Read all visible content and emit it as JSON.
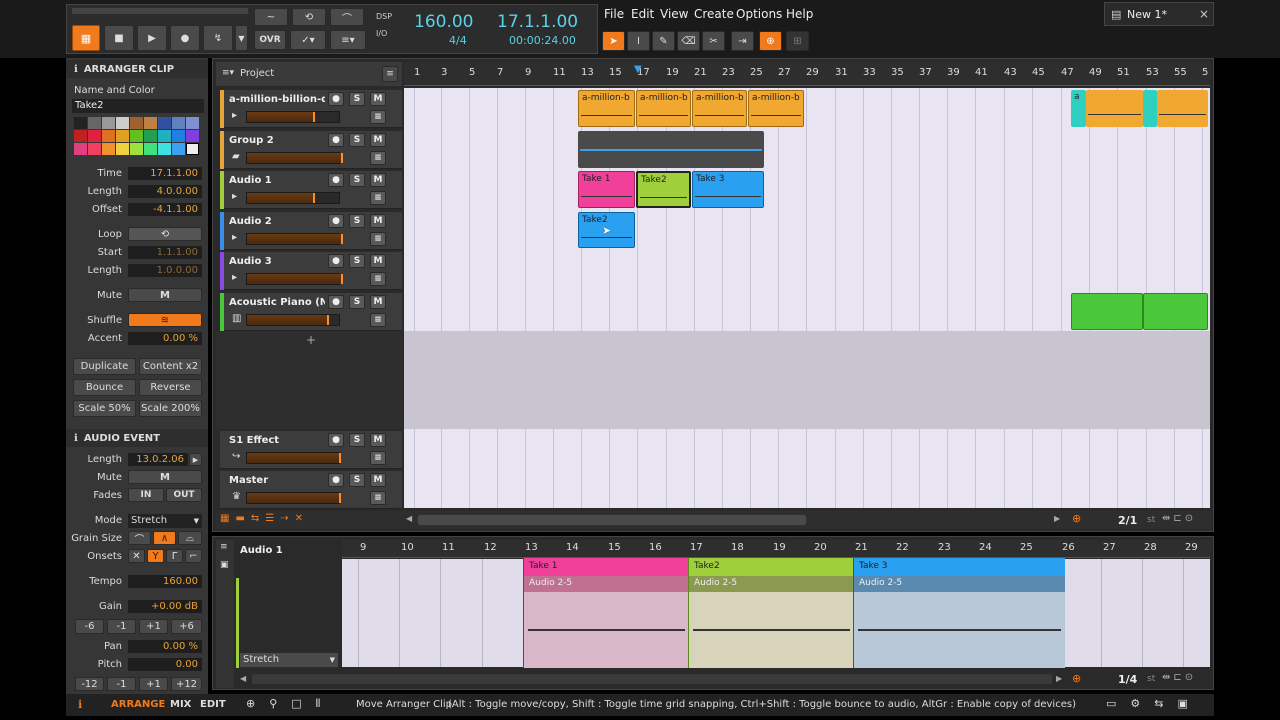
{
  "transport": {
    "dsp_label": "DSP",
    "io_label": "I/O",
    "tempo": "160.00",
    "time_sig": "4/4",
    "position": "17.1.1.00",
    "time": "00:00:24.00",
    "ovr": "OVR"
  },
  "menu": {
    "items": [
      "File",
      "Edit",
      "View",
      "Create",
      "Options",
      "Help"
    ]
  },
  "doc_tab": {
    "title": "New 1*",
    "close": "×"
  },
  "inspector": {
    "clip_header": "ARRANGER CLIP",
    "name_color_label": "Name and Color",
    "clip_name": "Take2",
    "time_label": "Time",
    "time_value": "17.1.1.00",
    "length_label": "Length",
    "length_value": "4.0.0.00",
    "offset_label": "Offset",
    "offset_value": "-4.1.1.00",
    "loop_label": "Loop",
    "start_label": "Start",
    "start_value": "1.1.1.00",
    "loop_length_label": "Length",
    "loop_length_value": "1.0.0.00",
    "mute_label": "Mute",
    "mute_btn": "M",
    "shuffle_label": "Shuffle",
    "accent_label": "Accent",
    "accent_value": "0.00 %",
    "duplicate": "Duplicate",
    "content_x2": "Content x2",
    "bounce": "Bounce",
    "reverse": "Reverse",
    "scale50": "Scale 50%",
    "scale200": "Scale 200%",
    "event_header": "AUDIO EVENT",
    "ev_length_label": "Length",
    "ev_length_value": "13.0.2.06",
    "ev_mute_label": "Mute",
    "ev_mute_btn": "M",
    "fades_label": "Fades",
    "fade_in": "IN",
    "fade_out": "OUT",
    "mode_label": "Mode",
    "mode_value": "Stretch",
    "grain_label": "Grain Size",
    "onsets_label": "Onsets",
    "tempo_label": "Tempo",
    "tempo_value": "160.00",
    "gain_label": "Gain",
    "gain_value": "+0.00 dB",
    "gain_steps": [
      "-6",
      "-1",
      "+1",
      "+6"
    ],
    "pan_label": "Pan",
    "pan_value": "0.00 %",
    "pitch_label": "Pitch",
    "pitch_value": "0.00",
    "pitch_steps": [
      "-12",
      "-1",
      "+1",
      "+12"
    ]
  },
  "arranger": {
    "project_label": "Project",
    "ruler": [
      "1",
      "3",
      "5",
      "7",
      "9",
      "11",
      "13",
      "15",
      "17",
      "19",
      "21",
      "23",
      "25",
      "27",
      "29",
      "31",
      "33",
      "35",
      "37",
      "39",
      "41",
      "43",
      "45",
      "47",
      "49",
      "51",
      "53",
      "55",
      "5"
    ],
    "tracks": [
      {
        "name": "a-million-billion-d...",
        "color": "#e8a33a"
      },
      {
        "name": "Group 2",
        "color": "#e8a33a"
      },
      {
        "name": "Audio 1",
        "color": "#9fcf3a"
      },
      {
        "name": "Audio 2",
        "color": "#3a8fe8"
      },
      {
        "name": "Audio 3",
        "color": "#8a4ae8"
      },
      {
        "name": "Acoustic Piano (N...",
        "color": "#4ac83a"
      }
    ],
    "fx_tracks": [
      {
        "name": "S1 Effect"
      },
      {
        "name": "Master"
      }
    ],
    "clips": {
      "amillion": "a-million-b",
      "take1": "Take 1",
      "take2": "Take2",
      "take3": "Take 3",
      "take2b": "Take2",
      "small_a": "a"
    },
    "page": "2/1",
    "st_label": "st"
  },
  "detail": {
    "track_name": "Audio 1",
    "ruler": [
      "9",
      "10",
      "11",
      "12",
      "13",
      "14",
      "15",
      "16",
      "17",
      "18",
      "19",
      "20",
      "21",
      "22",
      "23",
      "24",
      "25",
      "26",
      "27",
      "28",
      "29"
    ],
    "clips": [
      {
        "name": "Take 1",
        "sub": "Audio 2-5"
      },
      {
        "name": "Take2",
        "sub": "Audio 2-5"
      },
      {
        "name": "Take 3",
        "sub": "Audio 2-5"
      }
    ],
    "mode": "Stretch",
    "page": "1/4",
    "st_label": "st"
  },
  "statusbar": {
    "arrange": "ARRANGE",
    "mix": "MIX",
    "edit": "EDIT",
    "message": "Move Arranger Clip",
    "hint": "(Alt : Toggle move/copy, Shift : Toggle time grid snapping, Ctrl+Shift : Toggle bounce to audio, AltGr : Enable copy of devices)"
  },
  "colors": {
    "accent": "#f07a1c",
    "pink": "#f0409a",
    "green": "#9fcf3a",
    "blue": "#2aa0f0",
    "orange": "#f0a830",
    "piano": "#4ac83a"
  }
}
